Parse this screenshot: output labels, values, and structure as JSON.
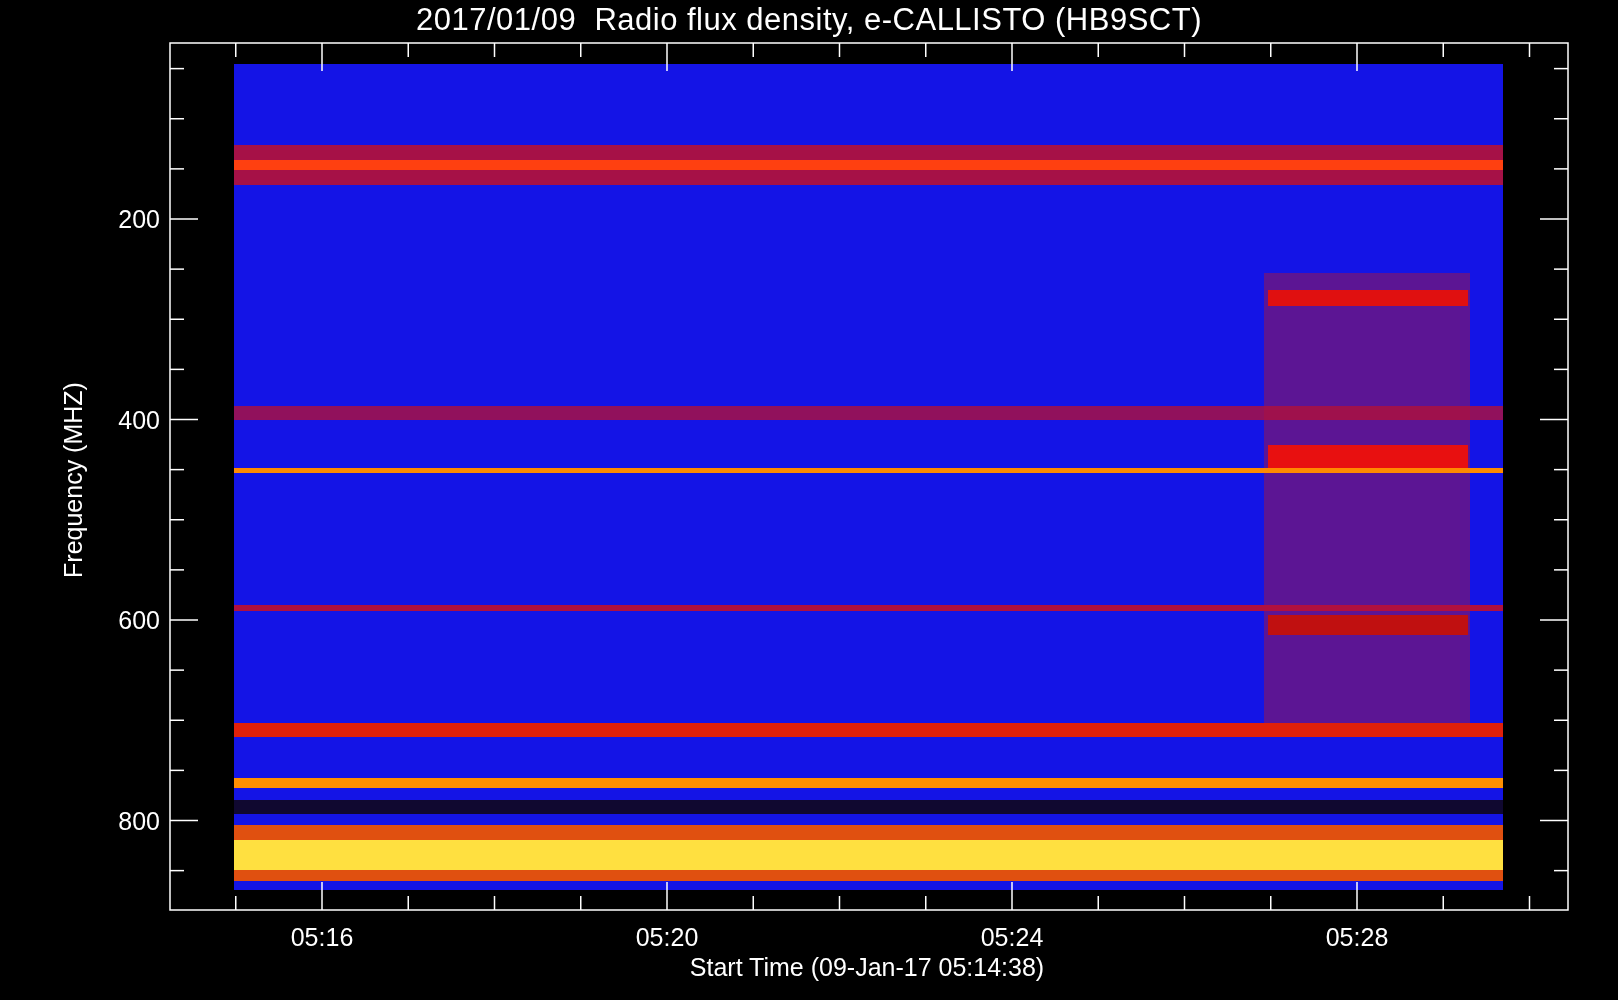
{
  "title": "2017/01/09  Radio flux density, e-CALLISTO (HB9SCT)",
  "y_axis": {
    "label": "Frequency (MHZ)",
    "ticks": [
      "200",
      "400",
      "600",
      "800"
    ]
  },
  "x_axis": {
    "label": "Start Time (09-Jan-17 05:14:38)",
    "ticks": [
      "05:16",
      "05:20",
      "05:24",
      "05:28"
    ]
  }
}
